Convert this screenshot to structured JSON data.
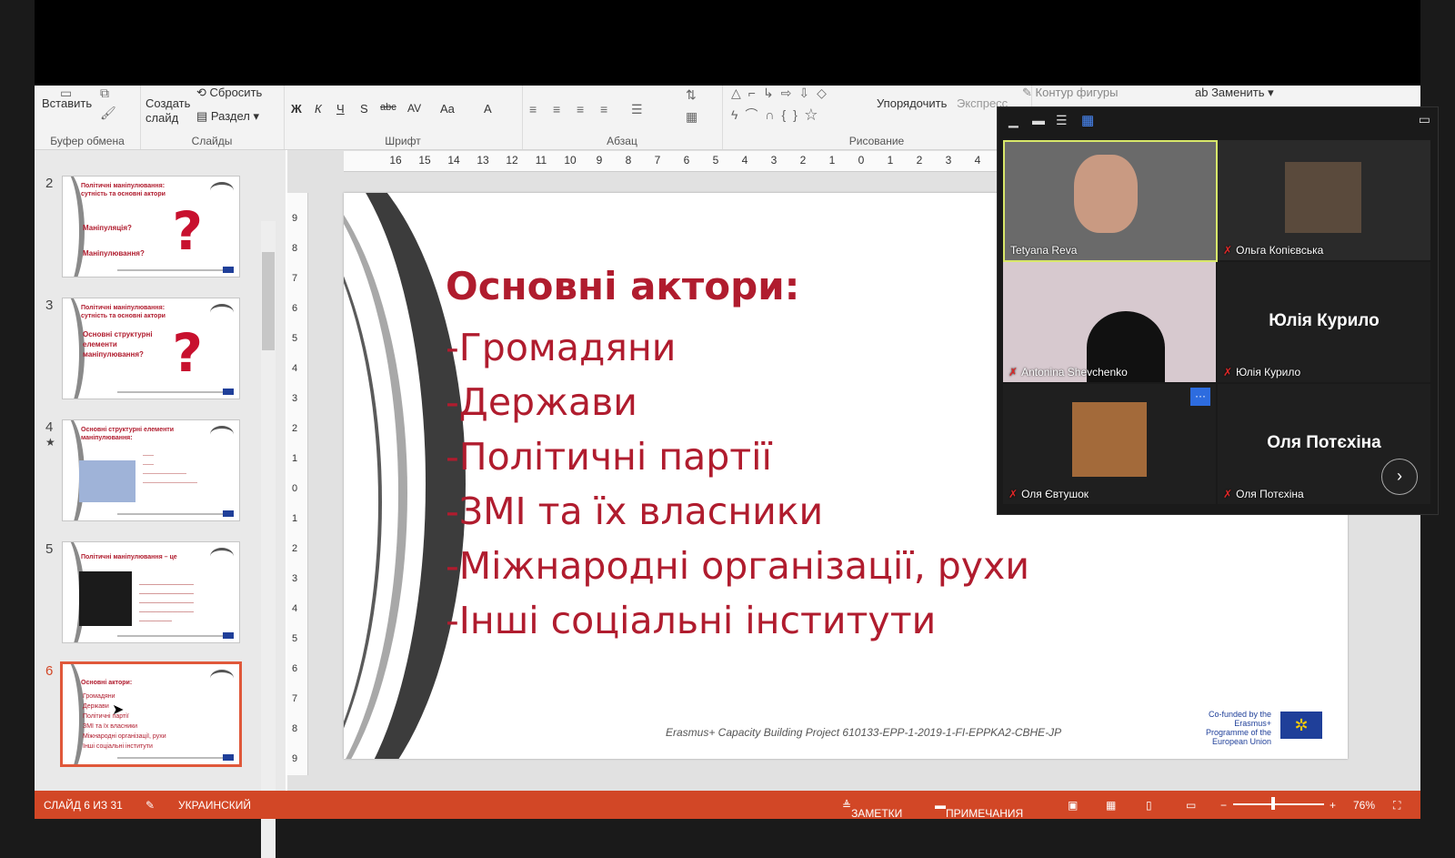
{
  "ribbon": {
    "paste": "Вставить",
    "create_slide": "Создать слайд",
    "reset": "Сбросить",
    "section": "Раздел",
    "clipboard": "Буфер обмена",
    "slides": "Слайды",
    "font": "Шрифт",
    "paragraph": "Абзац",
    "arrange": "Упорядочить",
    "express": "Экспресс",
    "drawing": "Рисование",
    "shape_outline": "Контур фигуры",
    "replace": "Заменить",
    "bold": "Ж",
    "italic": "К",
    "underline": "Ч",
    "shadow": "S",
    "strike": "abc",
    "spacing": "AV",
    "case": "Aa",
    "color": "A"
  },
  "ruler": {
    "h_ticks": [
      "16",
      "15",
      "14",
      "13",
      "12",
      "11",
      "10",
      "9",
      "8",
      "7",
      "6",
      "5",
      "4",
      "3",
      "2",
      "1",
      "0",
      "1",
      "2",
      "3",
      "4"
    ],
    "v_ticks": [
      "9",
      "8",
      "7",
      "6",
      "5",
      "4",
      "3",
      "2",
      "1",
      "0",
      "1",
      "2",
      "3",
      "4",
      "5",
      "6",
      "7",
      "8",
      "9"
    ]
  },
  "thumbnails": [
    {
      "num": "2",
      "title": "Політичні маніпулювання: сутність та основні актори",
      "body": "Маніпуляція?\n\nМаніпулювання?"
    },
    {
      "num": "3",
      "title": "Політичні маніпулювання: сутність та основні актори",
      "body": "Основні структурні елементи маніпулювання?"
    },
    {
      "num": "4",
      "title": "Основні структурні елементи маніпулювання:",
      "body": ""
    },
    {
      "num": "5",
      "title": "Політичні маніпулювання – це",
      "body": ""
    },
    {
      "num": "6",
      "title": "Основні актори:",
      "body": "Громадяни\nДержави\nПолітичні партії\nЗМІ та їх власники\nМіжнародні організації, рухи\nІнші соціальні інститути"
    }
  ],
  "slide": {
    "title": "Основні актори:",
    "items": [
      "-Громадяни",
      "-Держави",
      "-Політичні партії",
      "-ЗМІ та їх власники",
      "-Міжнародні організації, рухи",
      "-Інші соціальні інститути"
    ],
    "footer": "Erasmus+ Capacity Building Project  610133-EPP-1-2019-1-FI-EPPKA2-CBHE-JP",
    "cofunded": "Co-funded by the Erasmus+ Programme of the European Union"
  },
  "status": {
    "slide_counter": "СЛАЙД 6 ИЗ 31",
    "language": "УКРАИНСКИЙ",
    "notes": "ЗАМЕТКИ",
    "comments": "ПРИМЕЧАНИЯ",
    "zoom": "76%"
  },
  "zoom_panel": {
    "participants": [
      {
        "name": "Tetyana Reva",
        "video": true,
        "active": true,
        "muted": false
      },
      {
        "name": "Ольга Копієвська",
        "video": true,
        "active": false,
        "muted": true
      },
      {
        "name": "Antonina Shevchenko",
        "video": true,
        "active": false,
        "muted": true
      },
      {
        "name": "Юлія Курило",
        "video": false,
        "display": "Юлія Курило",
        "active": false,
        "muted": true
      },
      {
        "name": "Оля Євтушок",
        "video": true,
        "active": false,
        "muted": true
      },
      {
        "name": "Оля Потєхіна",
        "video": false,
        "display": "Оля Потєхіна",
        "active": false,
        "muted": true
      }
    ]
  },
  "colors": {
    "accent": "#b01c2e",
    "status_bar": "#d24726",
    "zoom_active": "#d8e76a"
  }
}
